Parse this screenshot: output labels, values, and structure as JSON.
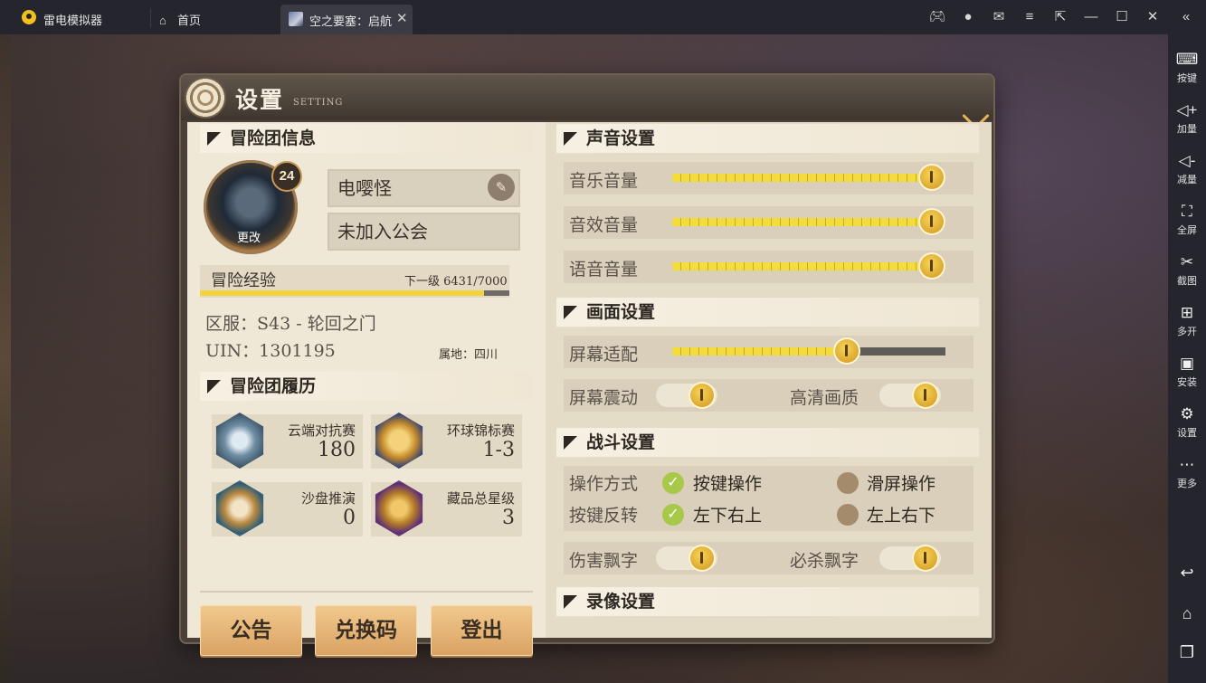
{
  "titlebar": {
    "app_title": "雷电模拟器",
    "home_tab": "首页",
    "game_tab": "空之要塞：启航"
  },
  "sidebar": {
    "items": [
      {
        "label": "按键",
        "icon": "keyboard-icon"
      },
      {
        "label": "加量",
        "icon": "volume-up-icon"
      },
      {
        "label": "减量",
        "icon": "volume-down-icon"
      },
      {
        "label": "全屏",
        "icon": "fullscreen-icon"
      },
      {
        "label": "截图",
        "icon": "scissors-icon"
      },
      {
        "label": "多开",
        "icon": "multi-instance-icon"
      },
      {
        "label": "安装",
        "icon": "apk-icon"
      },
      {
        "label": "设置",
        "icon": "gear-icon"
      },
      {
        "label": "更多",
        "icon": "more-icon"
      }
    ]
  },
  "panel": {
    "title": "设置",
    "subtitle": "SETTING"
  },
  "adventure": {
    "section": "冒险团信息",
    "level": "24",
    "change_label": "更改",
    "name": "电嘤怪",
    "guild": "未加入公会",
    "exp_label": "冒险经验",
    "exp_next": "下一级 6431/7000",
    "exp_fraction": 0.9187,
    "server": "区服：S43 - 轮回之门",
    "uin": "UIN：1301195",
    "region": "属地：四川"
  },
  "history": {
    "section": "冒险团履历",
    "cards": [
      {
        "name": "云端对抗赛",
        "value": "180",
        "icon": "cloud-arena-badge-icon"
      },
      {
        "name": "环球锦标赛",
        "value": "1-3",
        "icon": "world-championship-badge-icon"
      },
      {
        "name": "沙盘推演",
        "value": "0",
        "icon": "sandbox-badge-icon"
      },
      {
        "name": "藏品总星级",
        "value": "3",
        "icon": "collection-badge-icon"
      }
    ]
  },
  "buttons": {
    "notice": "公告",
    "redeem": "兑换码",
    "logout": "登出"
  },
  "sound": {
    "section": "声音设置",
    "music": {
      "label": "音乐音量",
      "value": 1.0
    },
    "sfx": {
      "label": "音效音量",
      "value": 1.0
    },
    "voice": {
      "label": "语音音量",
      "value": 1.0
    }
  },
  "display": {
    "section": "画面设置",
    "fit": {
      "label": "屏幕适配",
      "value": 0.64
    },
    "shake": {
      "label": "屏幕震动",
      "on": true
    },
    "hd": {
      "label": "高清画质",
      "on": true
    }
  },
  "battle": {
    "section": "战斗设置",
    "mode_label": "操作方式",
    "mode_opt1": "按键操作",
    "mode_opt2": "滑屏操作",
    "invert_label": "按键反转",
    "invert_opt1": "左下右上",
    "invert_opt2": "左上右下",
    "damage": {
      "label": "伤害飘字",
      "on": true
    },
    "crit": {
      "label": "必杀飘字",
      "on": true
    }
  },
  "record": {
    "section": "录像设置"
  },
  "colors": {
    "accent_gold": "#e4b25a",
    "slider_fill": "#f3dc3e",
    "check_green": "#a8c84a"
  }
}
